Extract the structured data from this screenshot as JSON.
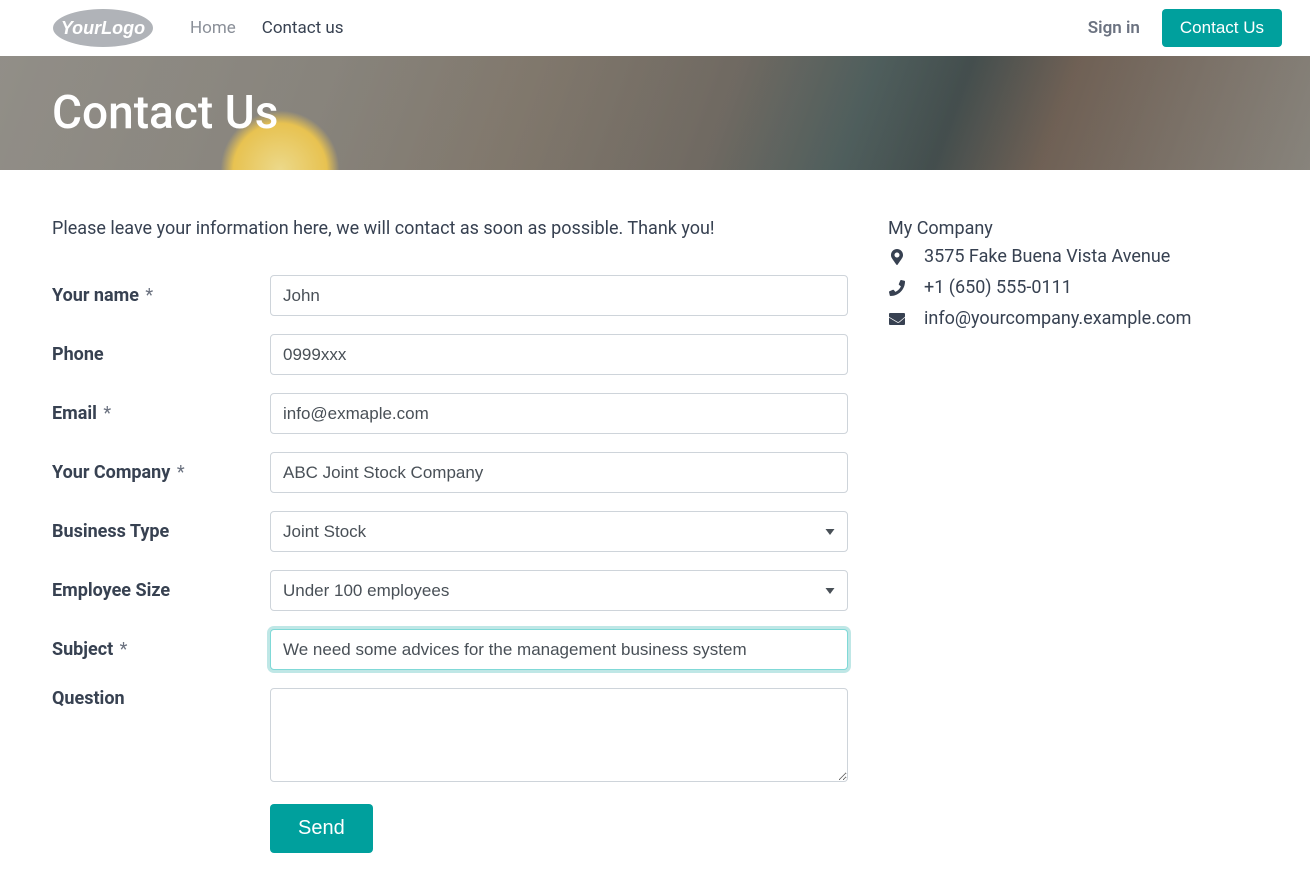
{
  "nav": {
    "home": "Home",
    "contact": "Contact us",
    "signin": "Sign in",
    "cta": "Contact Us"
  },
  "hero": {
    "title": "Contact Us"
  },
  "intro": "Please leave your information here, we will contact as soon as possible. Thank you!",
  "form": {
    "name_label": "Your name",
    "name_value": "John",
    "phone_label": "Phone",
    "phone_value": "0999xxx",
    "email_label": "Email",
    "email_value": "info@exmaple.com",
    "company_label": "Your Company",
    "company_value": "ABC Joint Stock Company",
    "btype_label": "Business Type",
    "btype_value": "Joint Stock",
    "esize_label": "Employee Size",
    "esize_value": "Under 100 employees",
    "subject_label": "Subject",
    "subject_value": "We need some advices for the management business system",
    "question_label": "Question",
    "question_value": "",
    "asterisk": "*",
    "send": "Send"
  },
  "company": {
    "name": "My Company",
    "address": "3575 Fake Buena Vista Avenue",
    "phone": "+1 (650) 555-0111",
    "email": "info@yourcompany.example.com"
  }
}
